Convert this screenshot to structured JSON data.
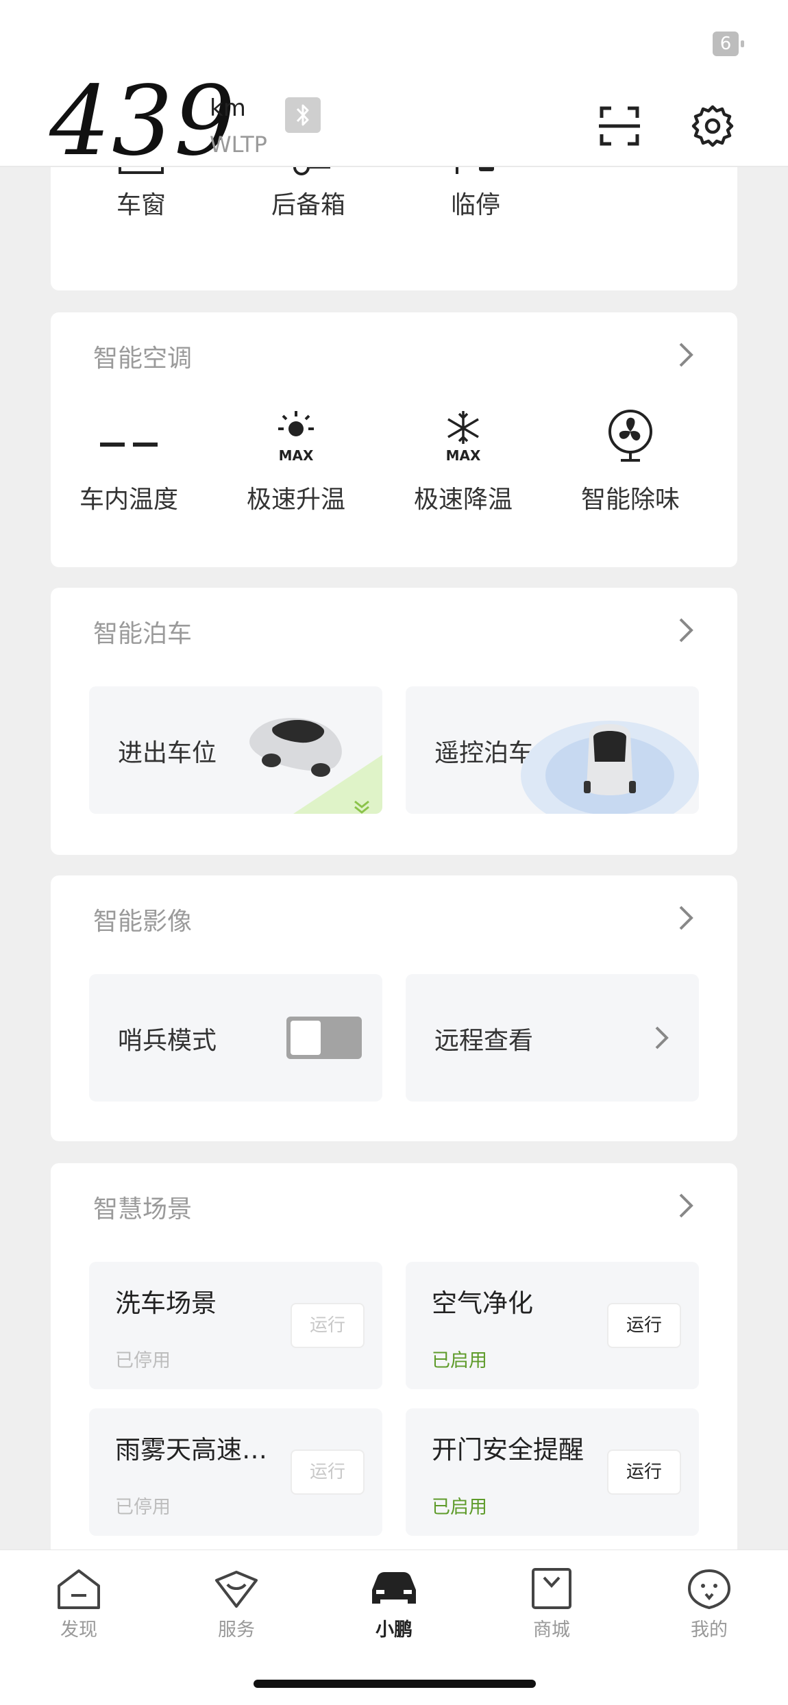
{
  "status_bar": {
    "battery_level": "6"
  },
  "header": {
    "range_value": "439",
    "range_unit": "km",
    "range_standard": "WLTP",
    "bluetooth_icon": "bluetooth-icon",
    "scan_icon": "scan-icon",
    "settings_icon": "gear-icon"
  },
  "quick_access": {
    "items": [
      {
        "label": "车窗",
        "icon": "car-window-icon"
      },
      {
        "label": "后备箱",
        "icon": "trunk-icon"
      },
      {
        "label": "临停",
        "icon": "parking-lock-icon"
      }
    ]
  },
  "climate": {
    "title": "智能空调",
    "items": [
      {
        "label": "车内温度",
        "value_placeholder": "--"
      },
      {
        "label": "极速升温",
        "icon": "sun-max-icon"
      },
      {
        "label": "极速降温",
        "icon": "snowflake-max-icon"
      },
      {
        "label": "智能除味",
        "icon": "fan-icon"
      }
    ]
  },
  "parking": {
    "title": "智能泊车",
    "tiles": [
      {
        "label": "进出车位"
      },
      {
        "label": "遥控泊车"
      }
    ]
  },
  "camera": {
    "title": "智能影像",
    "sentry_label": "哨兵模式",
    "sentry_enabled": false,
    "remote_view_label": "远程查看"
  },
  "scenes": {
    "title": "智慧场景",
    "items": [
      {
        "name": "洗车场景",
        "status": "已停用",
        "action": "运行",
        "enabled": false
      },
      {
        "name": "空气净化",
        "status": "已启用",
        "action": "运行",
        "enabled": true
      },
      {
        "name": "雨雾天高速…",
        "status": "已停用",
        "action": "运行",
        "enabled": false
      },
      {
        "name": "开门安全提醒",
        "status": "已启用",
        "action": "运行",
        "enabled": true
      }
    ]
  },
  "colors": {
    "enabled_green": "#5e9b2a",
    "disabled_gray": "#bdbdbd",
    "active_tab": "#222222",
    "inactive_tab": "#999999"
  },
  "tabbar": {
    "tabs": [
      {
        "label": "发现",
        "icon": "home-icon",
        "active": false
      },
      {
        "label": "服务",
        "icon": "service-icon",
        "active": false
      },
      {
        "label": "小鹏",
        "icon": "car-icon",
        "active": true
      },
      {
        "label": "商城",
        "icon": "shopping-bag-icon",
        "active": false
      },
      {
        "label": "我的",
        "icon": "profile-icon",
        "active": false
      }
    ]
  }
}
